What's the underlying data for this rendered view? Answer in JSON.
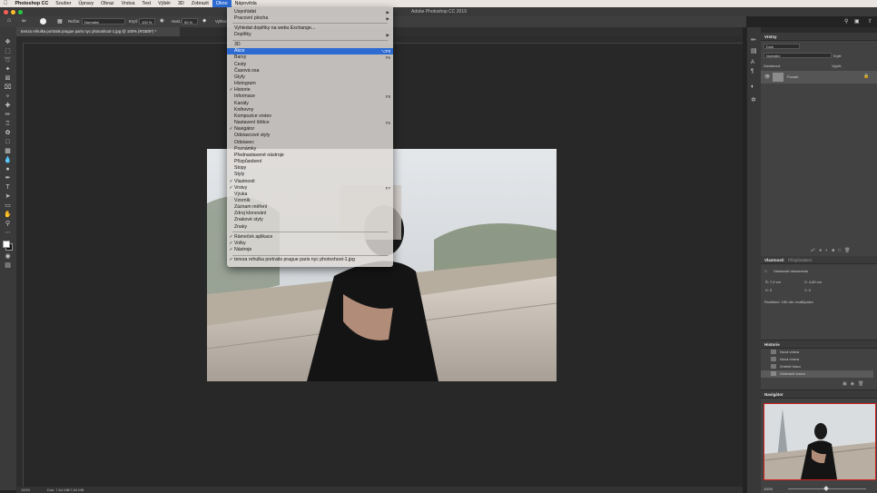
{
  "menubar": {
    "apple": "",
    "app_name": "Photoshop CC",
    "items": [
      "Soubor",
      "Úpravy",
      "Obraz",
      "Vrstva",
      "Text",
      "Výběr",
      "3D",
      "Zobrazit",
      "Okno",
      "Nápověda"
    ],
    "open_index": 8
  },
  "window": {
    "title": "Adobe Photoshop CC 2019",
    "document_tab": "tereza rehulka portraits prague paris nyc photoshoot-1.jpg @ 100% (RGB/8*) *"
  },
  "options": {
    "mode_label": "Režim:",
    "mode_value": "Normální",
    "opacity_label": "Krytí:",
    "opacity_value": "100 %",
    "flow_label": "Hust.:",
    "flow_value": "50 %",
    "smoothing_label": "Vyhlaz"
  },
  "menu": {
    "section1": [
      {
        "label": "Uspořádat",
        "submenu": true
      },
      {
        "label": "Pracovní plocha",
        "submenu": true
      }
    ],
    "section2": [
      {
        "label": "Vyhledat doplňky na webu Exchange..."
      },
      {
        "label": "Doplňky",
        "submenu": true
      }
    ],
    "section3": [
      {
        "label": "3D",
        "checked": false,
        "shortcut": ""
      },
      {
        "label": "Akce",
        "checked": false,
        "shortcut": "⌥F9",
        "highlighted": true
      },
      {
        "label": "Barvy",
        "checked": false,
        "shortcut": "F6"
      },
      {
        "label": "Cesty",
        "checked": false,
        "shortcut": ""
      },
      {
        "label": "Časová osa",
        "checked": false,
        "shortcut": ""
      },
      {
        "label": "Glyfy",
        "checked": false,
        "shortcut": ""
      },
      {
        "label": "Histogram",
        "checked": false,
        "shortcut": ""
      },
      {
        "label": "Historie",
        "checked": true,
        "shortcut": ""
      },
      {
        "label": "Informace",
        "checked": false,
        "shortcut": "F8"
      },
      {
        "label": "Kanály",
        "checked": false,
        "shortcut": ""
      },
      {
        "label": "Knihovny",
        "checked": false,
        "shortcut": ""
      },
      {
        "label": "Kompozice vrstev",
        "checked": false,
        "shortcut": ""
      },
      {
        "label": "Nastavení štětce",
        "checked": false,
        "shortcut": "F5"
      },
      {
        "label": "Navigátor",
        "checked": true,
        "shortcut": ""
      },
      {
        "label": "Odstavcové styly",
        "checked": false,
        "shortcut": ""
      },
      {
        "label": "Odstavec",
        "checked": false,
        "shortcut": ""
      },
      {
        "label": "Poznámky",
        "checked": false,
        "shortcut": ""
      },
      {
        "label": "Přednastavené nástroje",
        "checked": false,
        "shortcut": ""
      },
      {
        "label": "Přizpůsobení",
        "checked": false,
        "shortcut": ""
      },
      {
        "label": "Stopy",
        "checked": false,
        "shortcut": ""
      },
      {
        "label": "Styly",
        "checked": false,
        "shortcut": ""
      },
      {
        "label": "Vlastnosti",
        "checked": true,
        "shortcut": ""
      },
      {
        "label": "Vrstvy",
        "checked": true,
        "shortcut": "F7"
      },
      {
        "label": "Výuka",
        "checked": false,
        "shortcut": ""
      },
      {
        "label": "Vzorník",
        "checked": false,
        "shortcut": ""
      },
      {
        "label": "Záznam měření",
        "checked": false,
        "shortcut": ""
      },
      {
        "label": "Zdroj klonování",
        "checked": false,
        "shortcut": ""
      },
      {
        "label": "Znakové styly",
        "checked": false,
        "shortcut": ""
      },
      {
        "label": "Znaky",
        "checked": false,
        "shortcut": ""
      }
    ],
    "section4": [
      {
        "label": "Rámeček aplikace",
        "checked": true
      },
      {
        "label": "Volby",
        "checked": true
      },
      {
        "label": "Nástroje",
        "checked": true
      }
    ],
    "section5": [
      {
        "label": "tereza rehulka portraits prague paris nyc photoshoot-1.jpg",
        "checked": true
      }
    ]
  },
  "panels": {
    "layers": {
      "title": "Vrstvy",
      "search_placeholder": "Druh",
      "blend": "Normální",
      "opacity_label": "Krytí:",
      "lock_label": "Zamknout:",
      "fill_label": "Výplň:",
      "layer_name": "Pozadí"
    },
    "properties": {
      "tabs": [
        "Vlastnosti",
        "Přizpůsobení"
      ],
      "doc_label": "Vlastnosti dokumentu",
      "width": "Š: 7,9 cm",
      "height": "V: 4,83 cm",
      "x": "X: 0",
      "y": "Y: 0",
      "resolution": "Rozlišení: 150 obr. bodů/palec"
    },
    "history": {
      "title": "Historie",
      "items": [
        "Nová vrstva",
        "Nová vrstva",
        "Změnit hlavu",
        "Odstranit vrstvu"
      ]
    },
    "navigator": {
      "title": "Navigátor",
      "zoom": "100%"
    }
  },
  "status": {
    "zoom": "100%",
    "doc": "Dok: 7,64 MB/7,64 MB"
  },
  "colors": {
    "menu_highlight": "#2d6bd3",
    "menubar_bg": "#e9e4e0",
    "panel_bg": "#424242"
  }
}
